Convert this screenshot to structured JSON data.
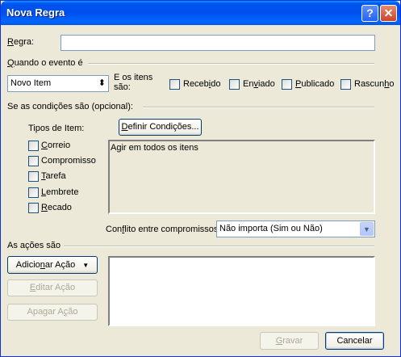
{
  "window": {
    "title": "Nova Regra"
  },
  "titlebar": {
    "help_glyph": "?",
    "close_glyph": "✕"
  },
  "rule": {
    "label_first": "R",
    "label_rest": "egra:",
    "value": ""
  },
  "event": {
    "section_first": "Q",
    "section_rest": "uando o evento é",
    "selected": "Novo Item",
    "items_label_line1": "E os itens",
    "items_label_line2": "são:",
    "checks": [
      {
        "pre": "Receb",
        "ul": "i",
        "post": "do",
        "checked": false
      },
      {
        "pre": "En",
        "ul": "v",
        "post": "iado",
        "checked": false
      },
      {
        "pre": "",
        "ul": "P",
        "post": "ublicado",
        "checked": false
      },
      {
        "pre": "Rascun",
        "ul": "h",
        "post": "o",
        "checked": false
      }
    ]
  },
  "conditions": {
    "section": "Se as condições são  (opcional):",
    "item_types_label": "Tipos de Item:",
    "define_btn_first": "D",
    "define_btn_rest": "efinir Condições...",
    "item_types": [
      {
        "ul": "C",
        "rest": "orreio",
        "checked": false
      },
      {
        "ul": "C",
        "rest": "ompromisso",
        "checked": false,
        "pre": ""
      },
      {
        "ul": "T",
        "rest": "arefa",
        "checked": false
      },
      {
        "ul": "L",
        "rest": "embrete",
        "checked": false
      },
      {
        "ul": "R",
        "rest": "ecado",
        "checked": false
      }
    ],
    "summary_text": "Agir em todos os itens",
    "conflict_label_pre": "Con",
    "conflict_label_ul": "f",
    "conflict_label_post": "lito entre compromissos:",
    "conflict_value": "Não importa (Sim ou Não)"
  },
  "actions": {
    "section": "As ações são",
    "add_pre": "Adicio",
    "add_ul": "n",
    "add_post": "ar Ação",
    "edit_ul": "E",
    "edit_rest": "ditar Ação",
    "delete_pre": "Apagar A",
    "delete_ul": "ç",
    "delete_post": "ão"
  },
  "footer": {
    "save_ul": "G",
    "save_rest": "ravar",
    "cancel": "Cancelar"
  },
  "colors": {
    "title_bg": "#0053ee",
    "dialog_bg": "#ece9d8"
  }
}
